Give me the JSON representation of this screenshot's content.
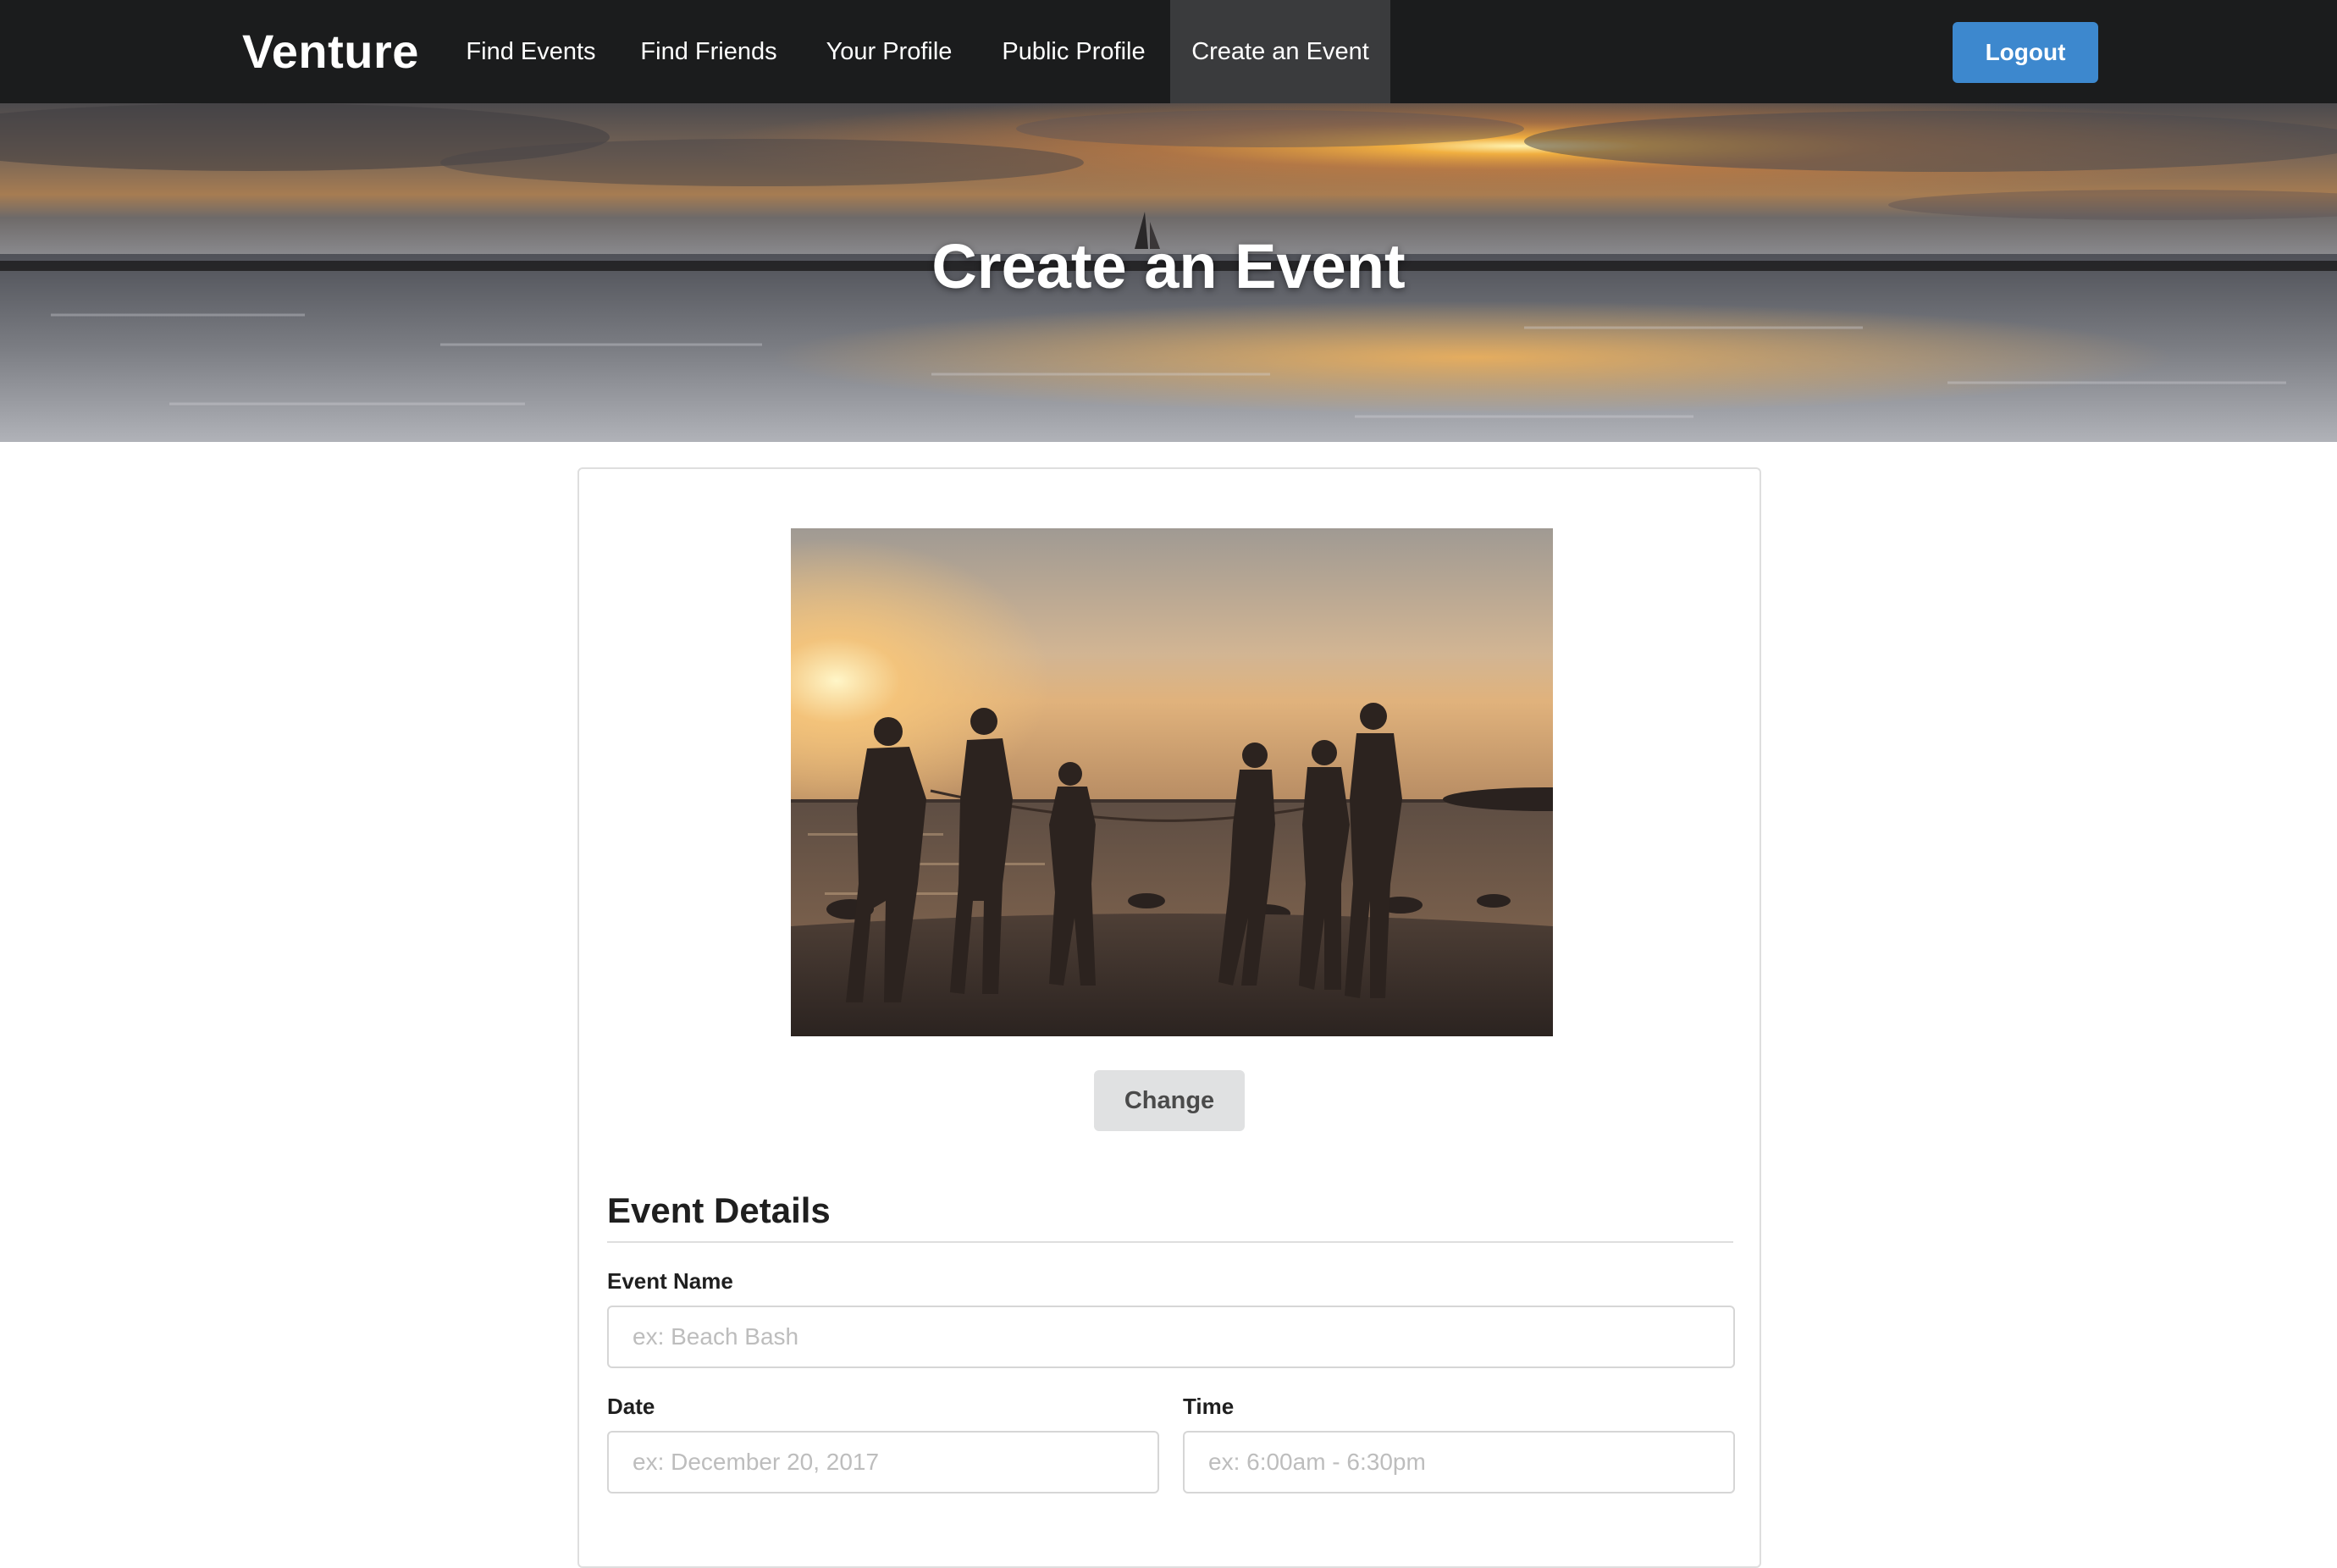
{
  "navbar": {
    "brand": "Venture",
    "items": [
      {
        "label": "Find Events",
        "active": false
      },
      {
        "label": "Find Friends",
        "active": false
      },
      {
        "label": "Your Profile",
        "active": false
      },
      {
        "label": "Public Profile",
        "active": false
      },
      {
        "label": "Create an Event",
        "active": true
      }
    ],
    "logout_label": "Logout",
    "colors": {
      "background": "#1b1c1d",
      "active_item": "#3a3b3d",
      "logout_button": "#3d88ce"
    }
  },
  "hero": {
    "title": "Create an Event",
    "image": "sunset-ocean-banner-image"
  },
  "card": {
    "image": "friends-tug-of-war-beach-sunset-image",
    "change_label": "Change",
    "section_title": "Event Details",
    "fields": {
      "event_name": {
        "label": "Event Name",
        "value": "",
        "placeholder": "ex: Beach Bash"
      },
      "date": {
        "label": "Date",
        "value": "",
        "placeholder": "ex: December 20, 2017"
      },
      "time": {
        "label": "Time",
        "value": "",
        "placeholder": "ex: 6:00am - 6:30pm"
      }
    }
  }
}
